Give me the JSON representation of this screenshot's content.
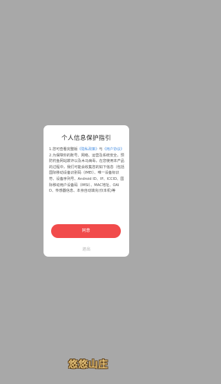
{
  "dialog": {
    "title": "个人信息保护指引",
    "para1_prefix": "1.您可查看完整版",
    "privacy_link": "《隐私政策》",
    "para1_mid": "与",
    "agreement_link": "《用户协议》",
    "para2": "2.为保障你的账号、网络、运营及系统安全，预防钓鱼网站欺诈以及木马病毒，在您使用本产品的过程中，我们可能会收集您的如下信息（包括国际移动设备识别码（IMEI）、唯一设备标识符、设备序列号、Android ID、IP、ICCID、国际移动用户设备码（IMSI）、MAC地址、OAID、传感器信息、本身自动填充(仅本机)等",
    "agree_label": "同意",
    "exit_label": "退出"
  },
  "brand": {
    "logo_text": "悠悠山庄"
  },
  "colors": {
    "overlay": "#a8a8a8",
    "primary": "#f14b4b",
    "link": "#4a90e2"
  }
}
